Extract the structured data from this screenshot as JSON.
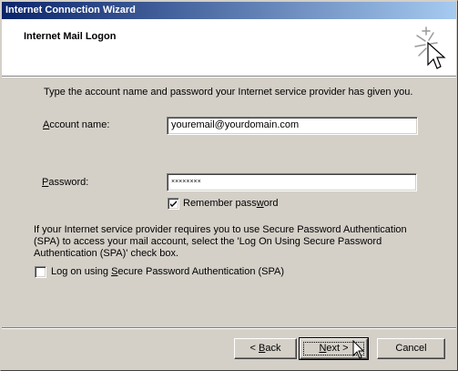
{
  "window": {
    "title": "Internet Connection Wizard"
  },
  "header": {
    "title": "Internet Mail Logon",
    "icon": "wizard-sparkle-cursor-icon"
  },
  "intro": "Type the account name and password your Internet service provider has given you.",
  "account": {
    "label_mnemonic": "A",
    "label_rest": "ccount name:",
    "value": "youremail@yourdomain.com"
  },
  "password": {
    "label_mnemonic": "P",
    "label_rest": "assword:",
    "masked_value": "××××××××"
  },
  "remember": {
    "label_pre": "Remember pass",
    "label_mnemonic": "w",
    "label_post": "ord",
    "checked": true
  },
  "spa_text": "If your Internet service provider requires you to use Secure Password Authentication (SPA) to access your mail account, select the 'Log On Using Secure Password Authentication (SPA)' check box.",
  "spa_checkbox": {
    "label_pre": "Log on using ",
    "label_mnemonic": "S",
    "label_post": "ecure Password Authentication (SPA)",
    "checked": false
  },
  "buttons": {
    "back_prefix": "< ",
    "back_mnemonic": "B",
    "back_rest": "ack",
    "next_mnemonic": "N",
    "next_rest": "ext >",
    "cancel": "Cancel"
  },
  "colors": {
    "titlebar_start": "#0a246a",
    "titlebar_end": "#a6caf0",
    "face": "#d4d0c8"
  }
}
